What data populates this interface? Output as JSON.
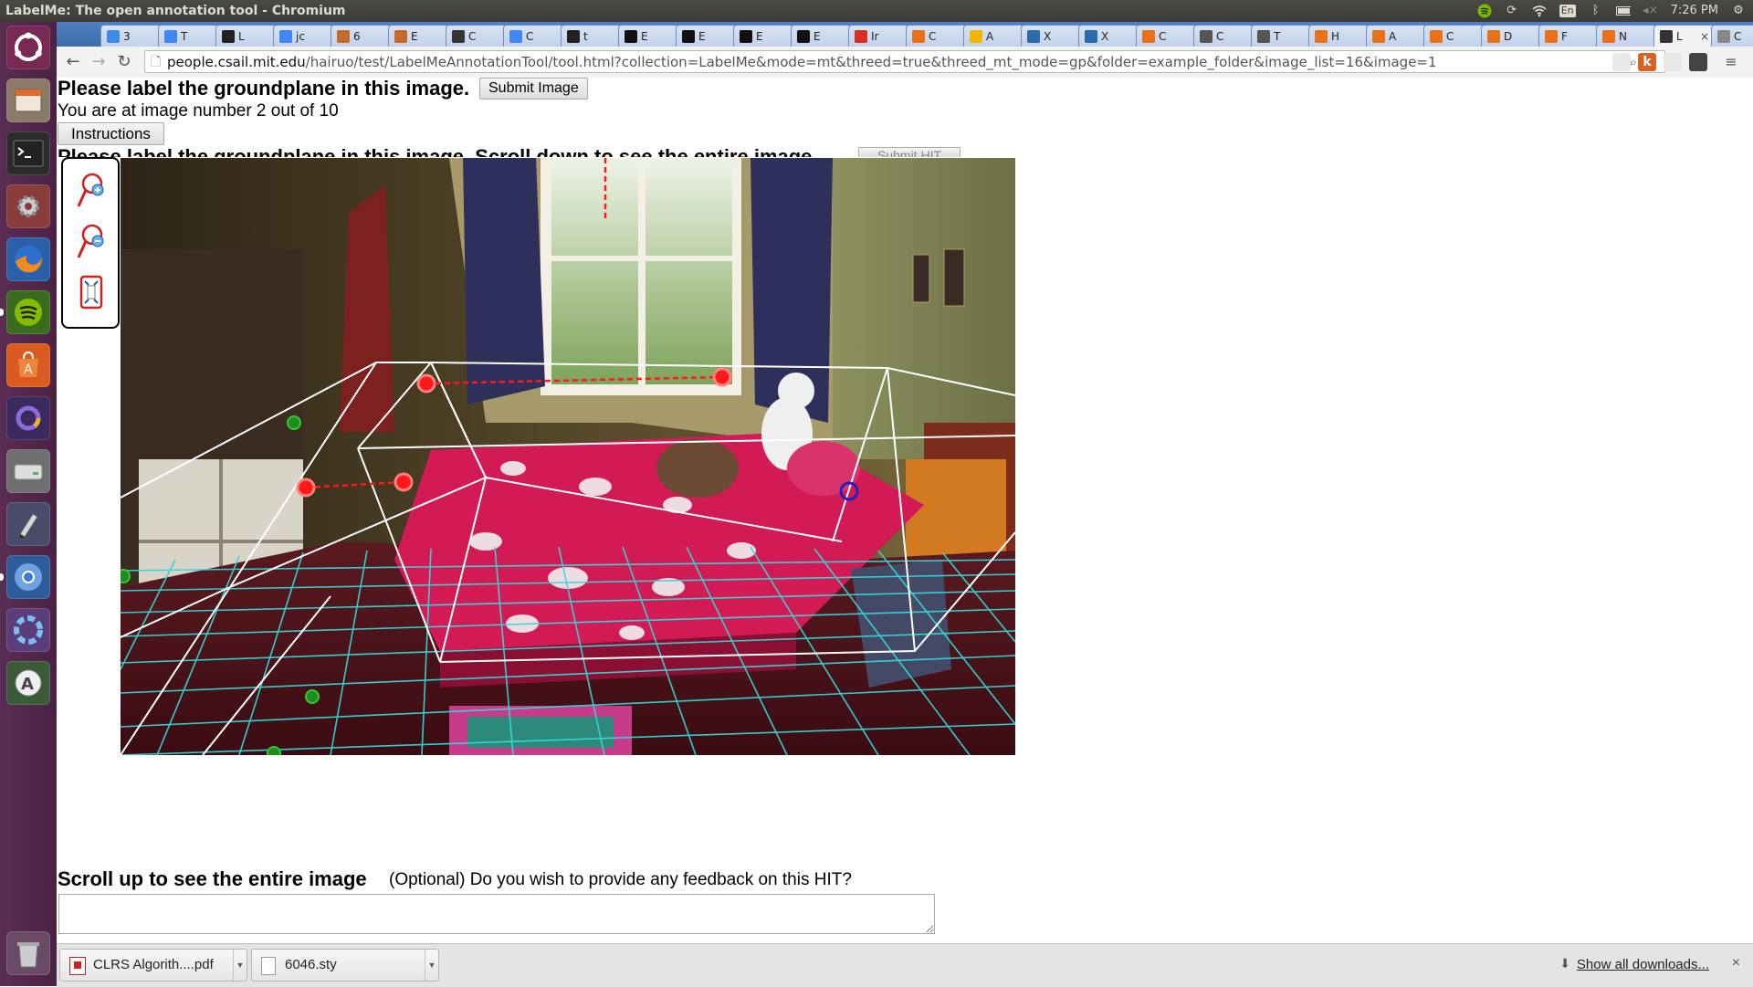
{
  "window": {
    "title": "LabelMe: The open annotation tool - Chromium"
  },
  "system_tray": {
    "keyboard": "En",
    "clock": "7:26 PM"
  },
  "tabs": [
    {
      "label": "3",
      "color": "#3c8be8"
    },
    {
      "label": "T",
      "color": "#4285f4"
    },
    {
      "label": "L",
      "color": "#222222"
    },
    {
      "label": "jc",
      "color": "#4285f4"
    },
    {
      "label": "6",
      "color": "#c56b2a"
    },
    {
      "label": "E",
      "color": "#c56b2a"
    },
    {
      "label": "C",
      "color": "#333333"
    },
    {
      "label": "C",
      "color": "#4285f4"
    },
    {
      "label": "t",
      "color": "#222222"
    },
    {
      "label": "E",
      "color": "#111111"
    },
    {
      "label": "E",
      "color": "#111111"
    },
    {
      "label": "E",
      "color": "#111111"
    },
    {
      "label": "E",
      "color": "#111111"
    },
    {
      "label": "Ir",
      "color": "#d93025"
    },
    {
      "label": "C",
      "color": "#e8711a"
    },
    {
      "label": "A",
      "color": "#f4b400"
    },
    {
      "label": "X",
      "color": "#2b6cb0"
    },
    {
      "label": "X",
      "color": "#2b6cb0"
    },
    {
      "label": "C",
      "color": "#e8711a"
    },
    {
      "label": "C",
      "color": "#555555"
    },
    {
      "label": "T",
      "color": "#555555"
    },
    {
      "label": "H",
      "color": "#e8711a"
    },
    {
      "label": "A",
      "color": "#e8711a"
    },
    {
      "label": "C",
      "color": "#e8711a"
    },
    {
      "label": "D",
      "color": "#e8711a"
    },
    {
      "label": "F",
      "color": "#e8711a"
    },
    {
      "label": "N",
      "color": "#e8711a"
    },
    {
      "label": "L",
      "color": "#333333",
      "active": true
    },
    {
      "label": "C",
      "color": "#888888"
    }
  ],
  "toolbar": {
    "url_host": "people.csail.mit.edu",
    "url_path": "/hairuo/test/LabelMeAnnotationTool/tool.html?collection=LabelMe&mode=mt&threed=true&threed_mt_mode=gp&folder=example_folder&image_list=16&image=1"
  },
  "page": {
    "heading": "Please label the groundplane in this image.",
    "submit_image_label": "Submit Image",
    "progress_text": "You are at image number 2 out of 10",
    "instructions_label": "Instructions",
    "heading2": "Please label the groundplane in this image. Scroll down to see the entire image.",
    "submit_hit_label": "Submit HIT",
    "scroll_up_text": "Scroll up to see the entire image",
    "feedback_prompt": "(Optional) Do you wish to provide any feedback on this HIT?",
    "feedback_value": ""
  },
  "tools": [
    "zoom-in-icon",
    "zoom-out-icon",
    "fit-image-icon"
  ],
  "downloads": {
    "items": [
      {
        "name": "CLRS Algorith....pdf",
        "icon": "pdf-icon"
      },
      {
        "name": "6046.sty",
        "icon": "file-icon"
      }
    ],
    "show_all_label": "Show all downloads...",
    "close_glyph": "×"
  }
}
